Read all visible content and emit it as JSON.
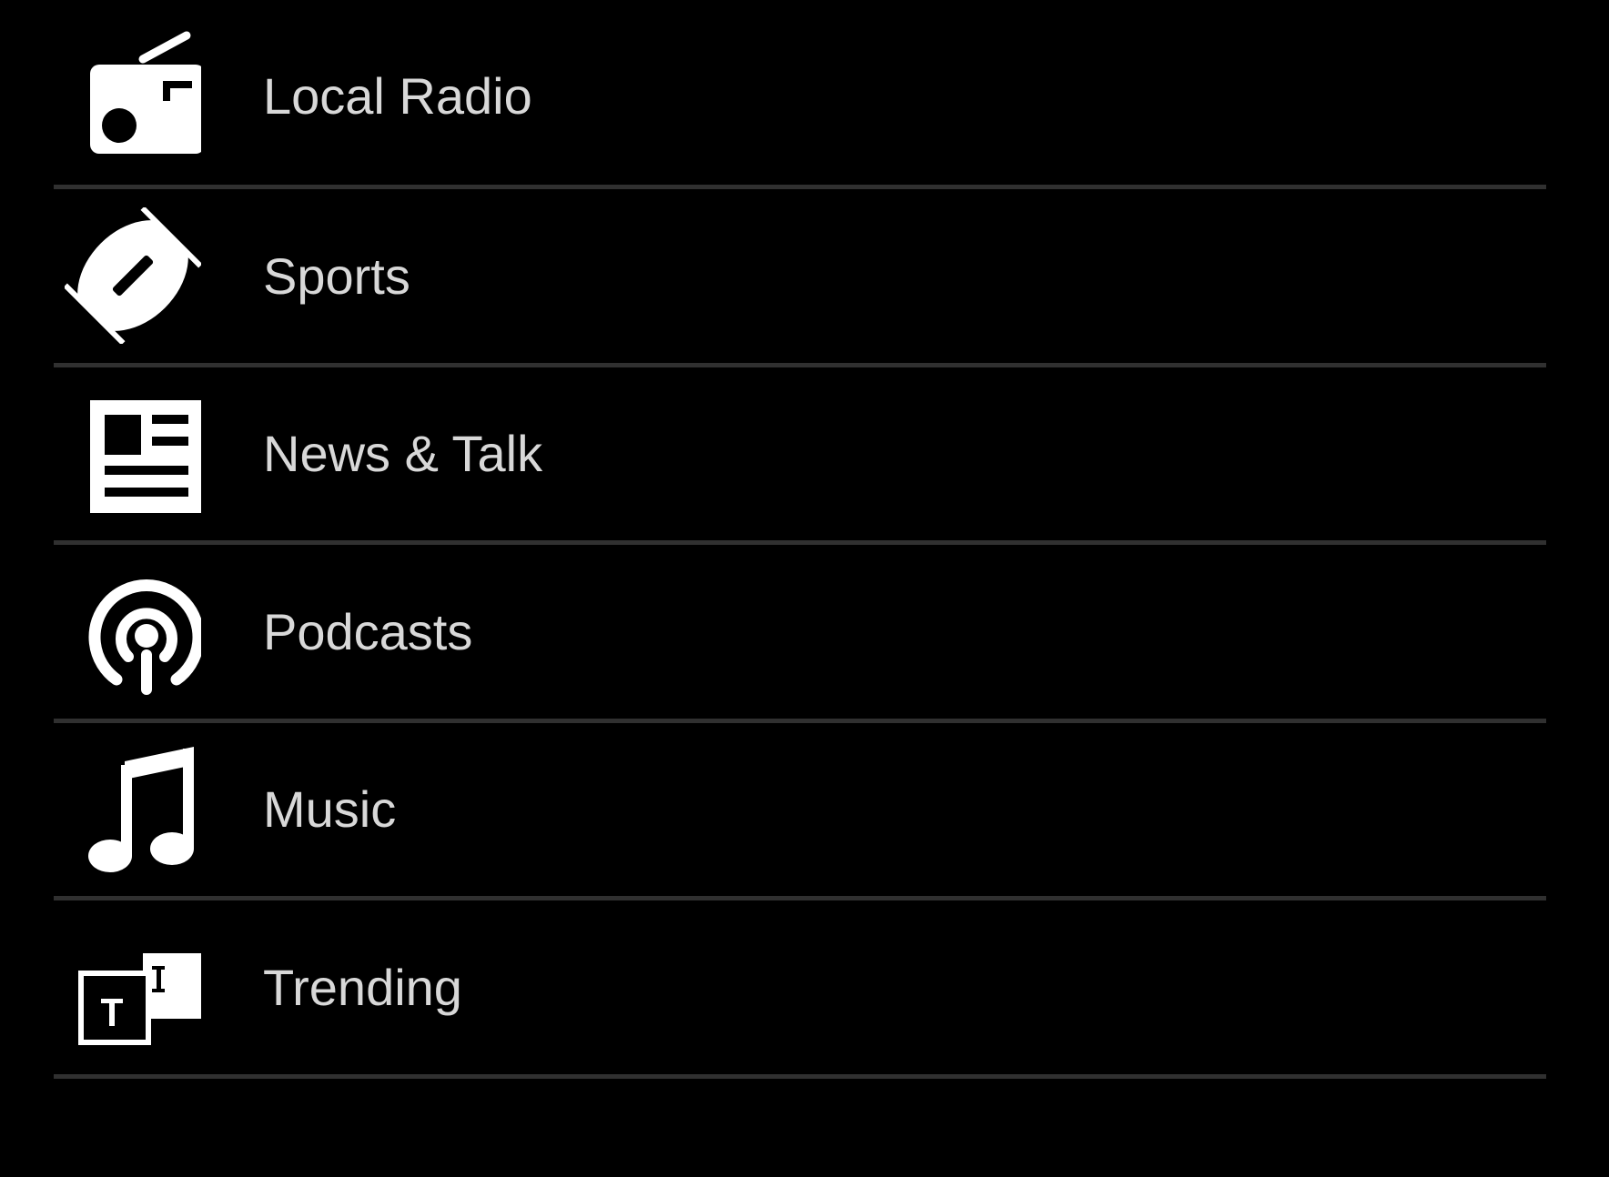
{
  "menu": {
    "items": [
      {
        "label": "Local Radio",
        "icon": "radio-icon"
      },
      {
        "label": "Sports",
        "icon": "football-icon"
      },
      {
        "label": "News & Talk",
        "icon": "newspaper-icon"
      },
      {
        "label": "Podcasts",
        "icon": "podcast-icon"
      },
      {
        "label": "Music",
        "icon": "music-note-icon"
      },
      {
        "label": "Trending",
        "icon": "trending-icon"
      }
    ]
  },
  "colors": {
    "background": "#000000",
    "text": "#d8d8d8",
    "icon": "#ffffff",
    "divider": "#303030"
  }
}
